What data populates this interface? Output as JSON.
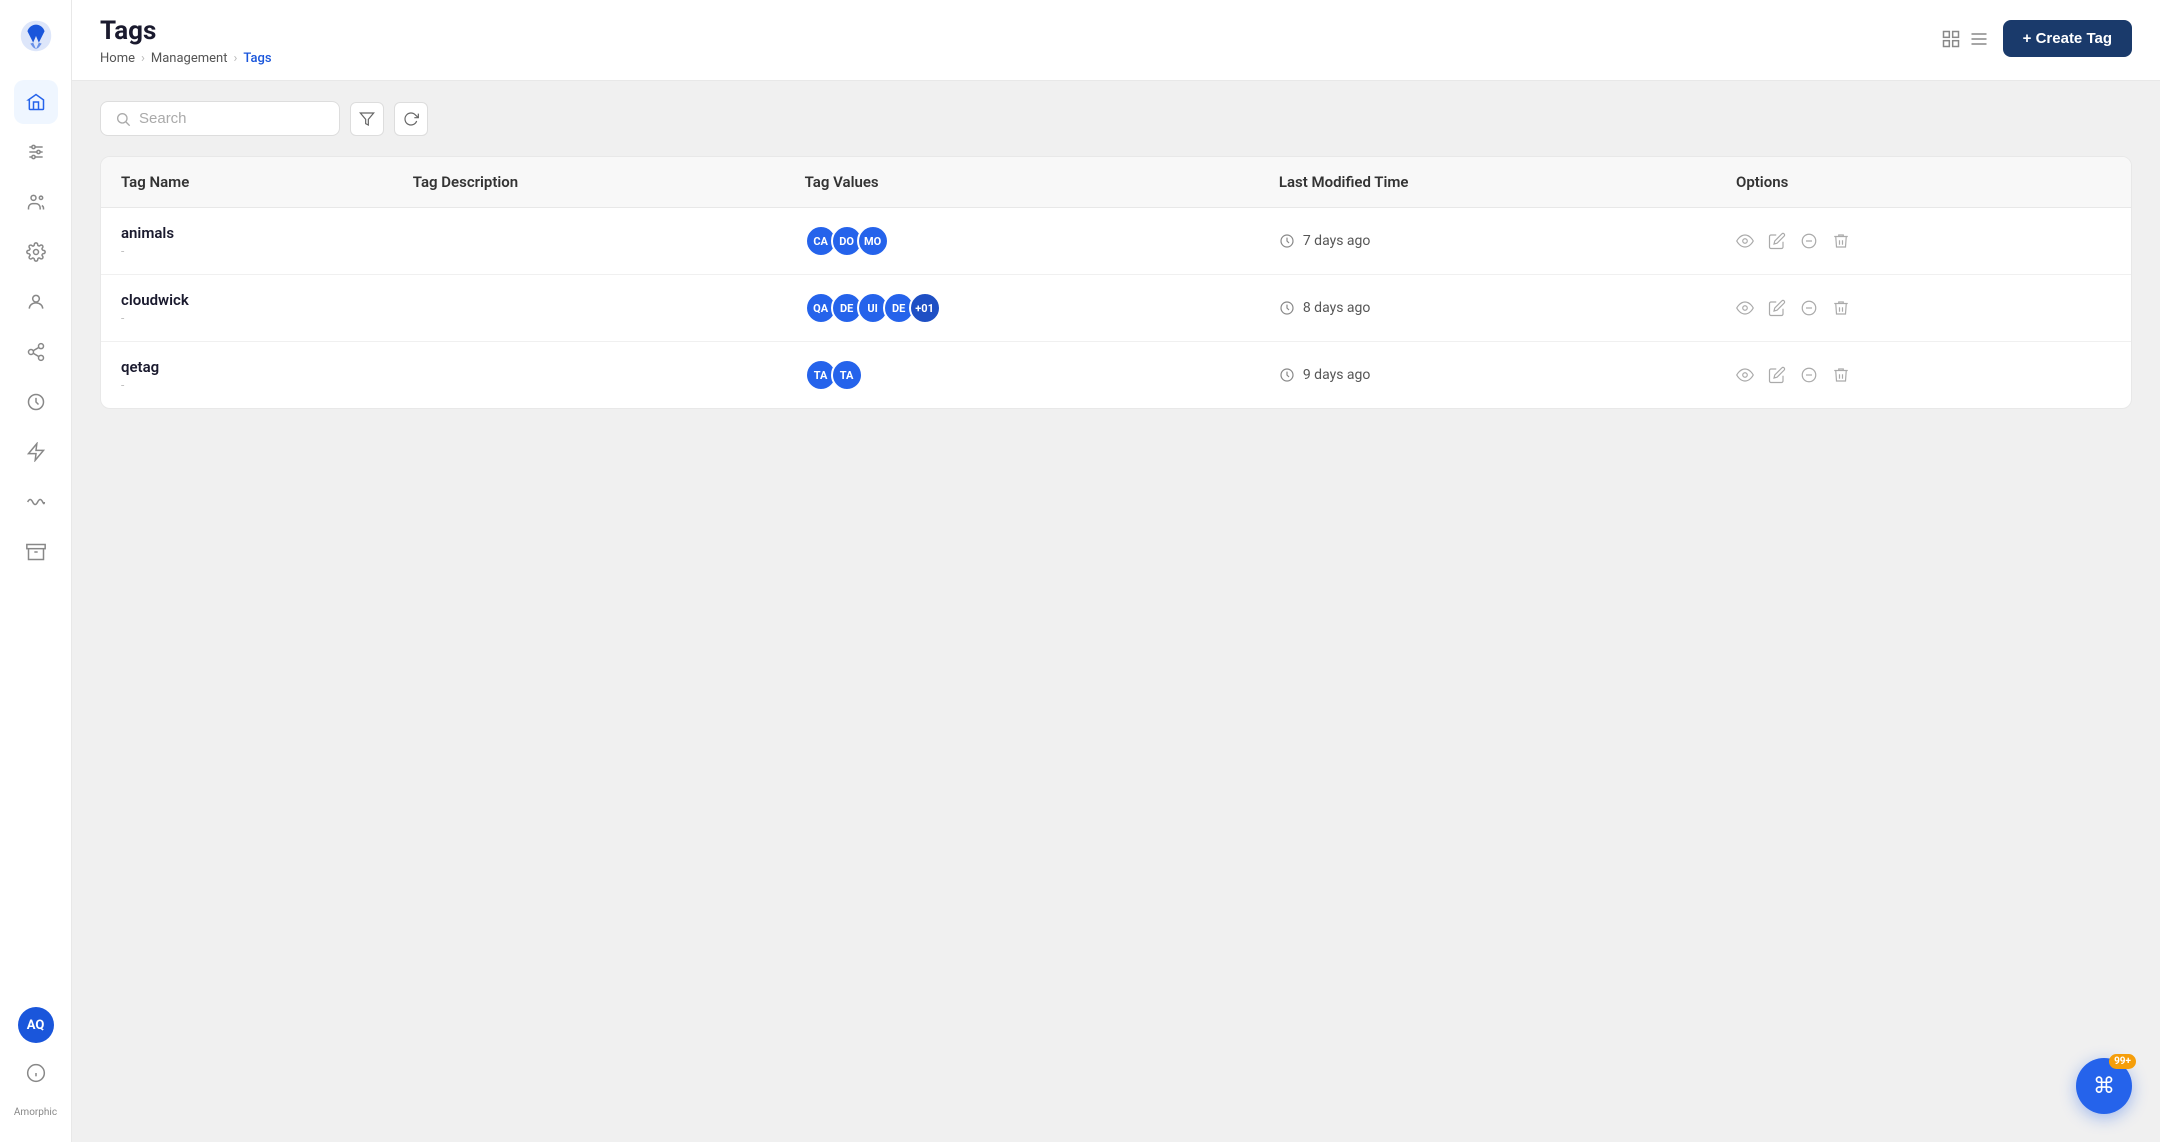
{
  "app": {
    "name": "Amorphic",
    "logo_text": "A"
  },
  "sidebar": {
    "avatar_initials": "AQ",
    "info_label": "Amorphic",
    "items": [
      {
        "name": "home",
        "icon": "home"
      },
      {
        "name": "filters",
        "icon": "sliders"
      },
      {
        "name": "team",
        "icon": "users"
      },
      {
        "name": "settings",
        "icon": "settings"
      },
      {
        "name": "profile",
        "icon": "user"
      },
      {
        "name": "connections",
        "icon": "share-2"
      },
      {
        "name": "history",
        "icon": "clock"
      },
      {
        "name": "lightning",
        "icon": "zap"
      },
      {
        "name": "waves",
        "icon": "activity"
      },
      {
        "name": "storage",
        "icon": "archive"
      }
    ]
  },
  "header": {
    "title": "Tags",
    "breadcrumb": [
      "Home",
      "Management",
      "Tags"
    ],
    "create_tag_label": "+ Create Tag"
  },
  "search": {
    "placeholder": "Search"
  },
  "table": {
    "columns": [
      "Tag Name",
      "Tag Description",
      "Tag Values",
      "Last Modified Time",
      "Options"
    ],
    "rows": [
      {
        "name": "animals",
        "description": "-",
        "values": [
          "CA",
          "DO",
          "MO"
        ],
        "extra_values": 0,
        "modified": "7 days ago"
      },
      {
        "name": "cloudwick",
        "description": "-",
        "values": [
          "QA",
          "DE",
          "UI",
          "DE"
        ],
        "extra_values": 1,
        "extra_label": "+01",
        "modified": "8 days ago"
      },
      {
        "name": "qetag",
        "description": "-",
        "values": [
          "TA",
          "TA"
        ],
        "extra_values": 0,
        "modified": "9 days ago"
      }
    ]
  },
  "fab": {
    "badge": "99+"
  }
}
